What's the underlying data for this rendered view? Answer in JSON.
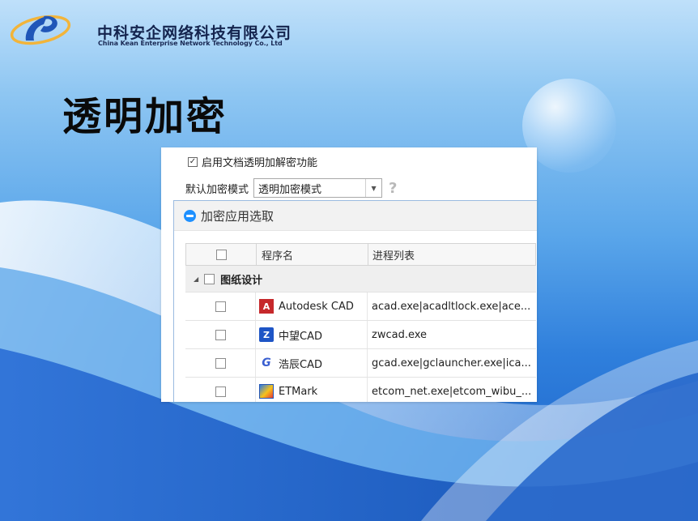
{
  "header": {
    "company_cn": "中科安企网络科技有限公司",
    "company_en": "China Kean Enterprise Network Technology Co., Ltd"
  },
  "page_title": "透明加密",
  "settings": {
    "enable_label": "启用文档透明加解密功能",
    "enable_checked": true,
    "mode_label": "默认加密模式",
    "mode_value": "透明加密模式"
  },
  "dialog": {
    "title": "加密应用选取",
    "columns": [
      "程序名",
      "进程列表"
    ],
    "group": {
      "label": "图纸设计",
      "checked": false
    },
    "rows": [
      {
        "name": "Autodesk CAD",
        "icon": "autodesk-icon",
        "process": "acad.exe|acadltlock.exe|ace...",
        "checked": false
      },
      {
        "name": "中望CAD",
        "icon": "zwcad-icon",
        "process": "zwcad.exe",
        "checked": false
      },
      {
        "name": "浩辰CAD",
        "icon": "gcad-icon",
        "process": "gcad.exe|gclauncher.exe|ica...",
        "checked": false
      },
      {
        "name": "ETMark",
        "icon": "etmark-icon",
        "process": "etcom_net.exe|etcom_wibu_...",
        "checked": false
      }
    ]
  },
  "colors": {
    "title_text": "#0a0a0a",
    "company_text": "#14244e",
    "accent_blue": "#1e90ff",
    "background_deep": "#1a5fc7",
    "background_light": "#bfe0fa"
  }
}
